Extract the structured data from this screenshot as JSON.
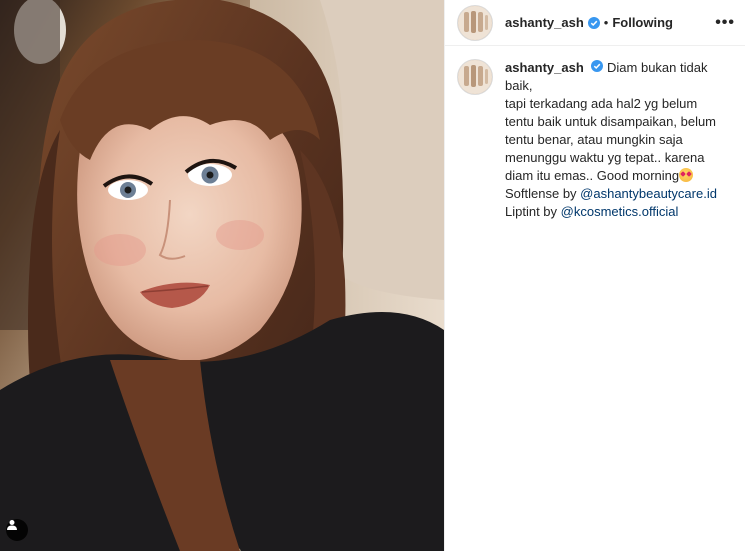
{
  "post": {
    "user_tag_icon": "person-icon"
  },
  "header": {
    "username": "ashanty_ash",
    "verified_icon": "verified-badge-icon",
    "separator": "•",
    "follow_status": "Following",
    "more_icon": "more-options-icon",
    "more_label": "•••"
  },
  "caption": {
    "username": "ashanty_ash",
    "line1": "Diam bukan tidak baik,",
    "line2": "tapi terkadang ada hal2 yg belum",
    "line3": "tentu baik untuk disampaikan, belum",
    "line4": "tentu benar, atau mungkin saja",
    "line5": "menunggu waktu yg tepat.. karena",
    "line6": "diam itu emas.. Good morning",
    "emoji": "star-struck-emoji",
    "softlense_prefix": "Softlense by ",
    "softlense_link": "@ashantybeautycare.id",
    "liptint_prefix": "Liptint by ",
    "liptint_link": "@kcosmetics.official"
  },
  "colors": {
    "link": "#00376b",
    "verified": "#3897f0",
    "text": "#262626",
    "border": "#efefef"
  }
}
